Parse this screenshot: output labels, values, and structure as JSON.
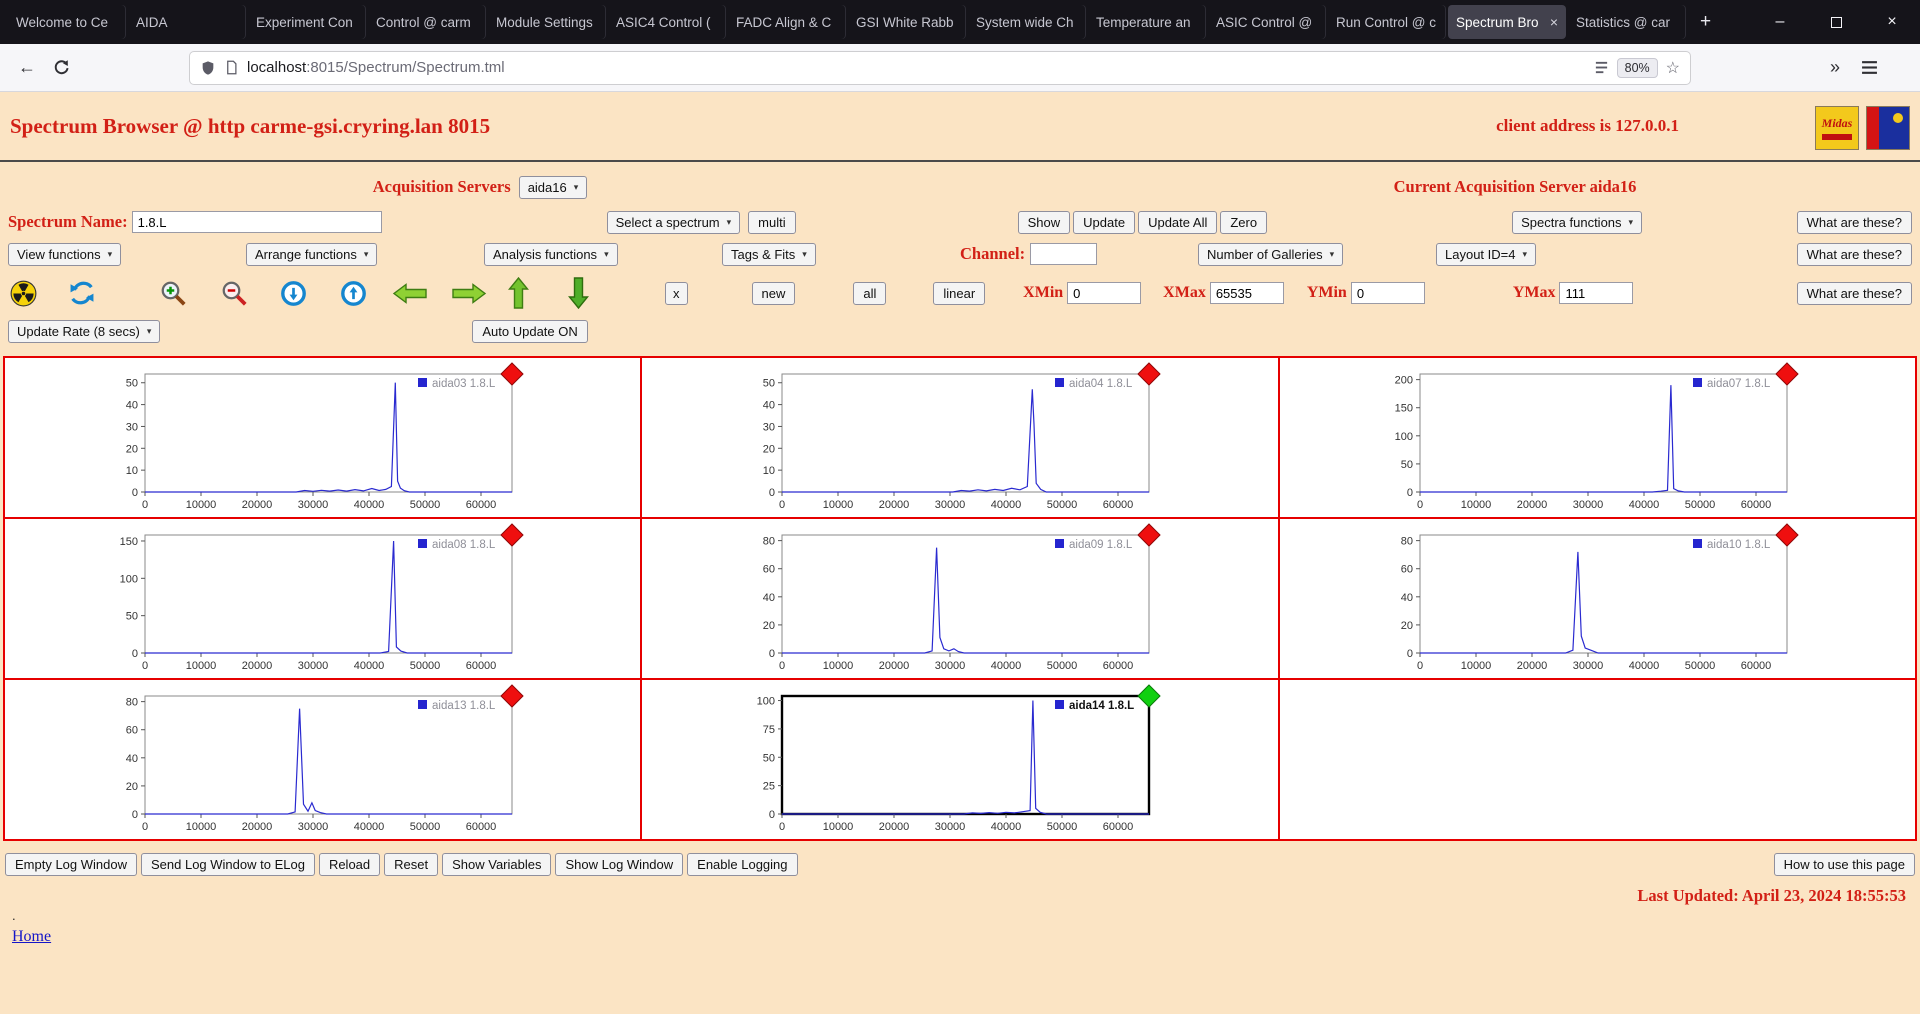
{
  "browser": {
    "tabs": [
      "Welcome to Ce",
      "AIDA",
      "Experiment Con",
      "Control @ carm",
      "Module Settings",
      "ASIC4 Control (",
      "FADC Align & C",
      "GSI White Rabb",
      "System wide Ch",
      "Temperature an",
      "ASIC Control @",
      "Run Control @ c",
      "Spectrum Bro",
      "Statistics @ car"
    ],
    "active_index": 12,
    "url_host": "localhost",
    "url_rest": ":8015/Spectrum/Spectrum.tml",
    "zoom_badge": "80%"
  },
  "icons": {
    "select_arrow": "▾",
    "back": "←",
    "overflow": "»",
    "star": "☆",
    "minimize": "–",
    "close": "×",
    "new_tab": "+"
  },
  "theme": {
    "page_bg": "#fbe4c4",
    "label_red": "#d22016",
    "grid_border_red": "#e60000",
    "spectrum_blue": "#2a2ad0",
    "marker_red": "#ef0f0f",
    "marker_green": "#10d010"
  },
  "page": {
    "title": "Spectrum Browser @ http carme-gsi.cryring.lan 8015",
    "client_address": "client address is 127.0.0.1",
    "logos": {
      "midas": "Midas"
    },
    "acquisition": {
      "label": "Acquisition Servers",
      "selected": "aida16",
      "current": "Current Acquisition Server aida16"
    },
    "controls": {
      "spectrum_name_label": "Spectrum Name:",
      "spectrum_name_value": "1.8.L",
      "select_a_spectrum": "Select a spectrum",
      "multi": "multi",
      "show": "Show",
      "update": "Update",
      "update_all": "Update All",
      "zero": "Zero",
      "spectra_functions": "Spectra functions",
      "what_are_these": "What are these?",
      "view_functions": "View functions",
      "arrange_functions": "Arrange functions",
      "analysis_functions": "Analysis functions",
      "tags_fits": "Tags & Fits",
      "channel_label": "Channel:",
      "channel_value": "",
      "number_of_galleries": "Number of Galleries",
      "layout_id": "Layout ID=4",
      "x": "x",
      "new": "new",
      "all": "all",
      "linear": "linear",
      "xmin_label": "XMin",
      "xmin_value": "0",
      "xmax_label": "XMax",
      "xmax_value": "65535",
      "ymin_label": "YMin",
      "ymin_value": "0",
      "ymax_label": "YMax",
      "ymax_value": "111",
      "update_rate": "Update Rate (8 secs)",
      "auto_update": "Auto Update ON"
    },
    "footer": {
      "buttons": [
        "Empty Log Window",
        "Send Log Window to ELog",
        "Reload",
        "Reset",
        "Show Variables",
        "Show Log Window",
        "Enable Logging"
      ],
      "help": "How to use this page",
      "last_updated": "Last Updated: April 23, 2024 18:55:53",
      "dot": ".",
      "home": "Home"
    }
  },
  "chart_data": {
    "type": "line",
    "x_range": [
      0,
      65535
    ],
    "x_ticks": [
      0,
      10000,
      20000,
      30000,
      40000,
      50000,
      60000
    ],
    "line_color": "#2a2ad0",
    "spectra": [
      {
        "name": "aida03",
        "legend": "aida03 1.8.L",
        "y_ticks": [
          0,
          10,
          20,
          30,
          40,
          50
        ],
        "y_axis_max": 54,
        "selected": false,
        "marker": "red",
        "points": [
          [
            0,
            0
          ],
          [
            27000,
            0
          ],
          [
            28500,
            0.7
          ],
          [
            30000,
            0.3
          ],
          [
            31500,
            0.8
          ],
          [
            33000,
            0.4
          ],
          [
            34500,
            0.9
          ],
          [
            36000,
            0.4
          ],
          [
            37500,
            1.1
          ],
          [
            39000,
            0.5
          ],
          [
            40500,
            1.6
          ],
          [
            41800,
            0.7
          ],
          [
            43000,
            1.2
          ],
          [
            44000,
            2.5
          ],
          [
            44700,
            50
          ],
          [
            45100,
            5
          ],
          [
            45600,
            1.8
          ],
          [
            46300,
            0.6
          ],
          [
            47200,
            0
          ],
          [
            65535,
            0
          ]
        ]
      },
      {
        "name": "aida04",
        "legend": "aida04 1.8.L",
        "y_ticks": [
          0,
          10,
          20,
          30,
          40,
          50
        ],
        "y_axis_max": 54,
        "selected": false,
        "marker": "red",
        "points": [
          [
            0,
            0
          ],
          [
            30500,
            0
          ],
          [
            32000,
            0.7
          ],
          [
            33500,
            0.4
          ],
          [
            35000,
            1
          ],
          [
            36500,
            0.5
          ],
          [
            38000,
            1.2
          ],
          [
            39500,
            0.7
          ],
          [
            41000,
            1.7
          ],
          [
            42500,
            1
          ],
          [
            43800,
            2.5
          ],
          [
            44700,
            47
          ],
          [
            45000,
            31
          ],
          [
            45400,
            4
          ],
          [
            46200,
            1.2
          ],
          [
            47200,
            0
          ],
          [
            65535,
            0
          ]
        ]
      },
      {
        "name": "aida07",
        "legend": "aida07 1.8.L",
        "y_ticks": [
          0,
          50,
          100,
          150,
          200
        ],
        "y_axis_max": 210,
        "selected": false,
        "marker": "red",
        "points": [
          [
            0,
            0
          ],
          [
            41500,
            0
          ],
          [
            43000,
            1.5
          ],
          [
            44200,
            3
          ],
          [
            44800,
            190
          ],
          [
            45300,
            6
          ],
          [
            46100,
            2
          ],
          [
            47200,
            0
          ],
          [
            65535,
            0
          ]
        ]
      },
      {
        "name": "aida08",
        "legend": "aida08 1.8.L",
        "y_ticks": [
          0,
          50,
          100,
          150
        ],
        "y_axis_max": 158,
        "selected": false,
        "marker": "red",
        "points": [
          [
            0,
            0
          ],
          [
            42000,
            0
          ],
          [
            43500,
            2
          ],
          [
            44400,
            150
          ],
          [
            44900,
            8
          ],
          [
            45700,
            2.5
          ],
          [
            46800,
            0
          ],
          [
            65535,
            0
          ]
        ]
      },
      {
        "name": "aida09",
        "legend": "aida09 1.8.L",
        "y_ticks": [
          0,
          20,
          40,
          60,
          80
        ],
        "y_axis_max": 84,
        "selected": false,
        "marker": "red",
        "points": [
          [
            0,
            0
          ],
          [
            25500,
            0
          ],
          [
            26800,
            1.5
          ],
          [
            27600,
            75
          ],
          [
            28200,
            11
          ],
          [
            28900,
            3
          ],
          [
            29800,
            1.5
          ],
          [
            30700,
            3
          ],
          [
            31500,
            1
          ],
          [
            32500,
            0
          ],
          [
            65535,
            0
          ]
        ]
      },
      {
        "name": "aida10",
        "legend": "aida10 1.8.L",
        "y_ticks": [
          0,
          20,
          40,
          60,
          80
        ],
        "y_axis_max": 84,
        "selected": false,
        "marker": "red",
        "points": [
          [
            0,
            0
          ],
          [
            26000,
            0
          ],
          [
            27300,
            2
          ],
          [
            28200,
            72
          ],
          [
            28800,
            12
          ],
          [
            29500,
            3.5
          ],
          [
            30500,
            2
          ],
          [
            31800,
            0
          ],
          [
            65535,
            0
          ]
        ]
      },
      {
        "name": "aida13",
        "legend": "aida13 1.8.L",
        "y_ticks": [
          0,
          20,
          40,
          60,
          80
        ],
        "y_axis_max": 84,
        "selected": false,
        "marker": "red",
        "points": [
          [
            0,
            0
          ],
          [
            25500,
            0
          ],
          [
            26800,
            1.5
          ],
          [
            27600,
            75
          ],
          [
            28300,
            7
          ],
          [
            29100,
            2
          ],
          [
            29800,
            8
          ],
          [
            30400,
            2.5
          ],
          [
            31300,
            1
          ],
          [
            32400,
            0
          ],
          [
            65535,
            0
          ]
        ]
      },
      {
        "name": "aida14",
        "legend": "aida14 1.8.L",
        "y_ticks": [
          0,
          25,
          50,
          75,
          100
        ],
        "y_axis_max": 104,
        "selected": true,
        "marker": "green",
        "points": [
          [
            0,
            0
          ],
          [
            32500,
            0
          ],
          [
            34000,
            1
          ],
          [
            35500,
            0.5
          ],
          [
            37000,
            1.2
          ],
          [
            38500,
            0.6
          ],
          [
            40000,
            1.5
          ],
          [
            41500,
            1
          ],
          [
            43000,
            2
          ],
          [
            44300,
            3
          ],
          [
            44800,
            100
          ],
          [
            45300,
            5
          ],
          [
            46100,
            1.5
          ],
          [
            47200,
            0
          ],
          [
            65535,
            0
          ]
        ]
      }
    ]
  }
}
